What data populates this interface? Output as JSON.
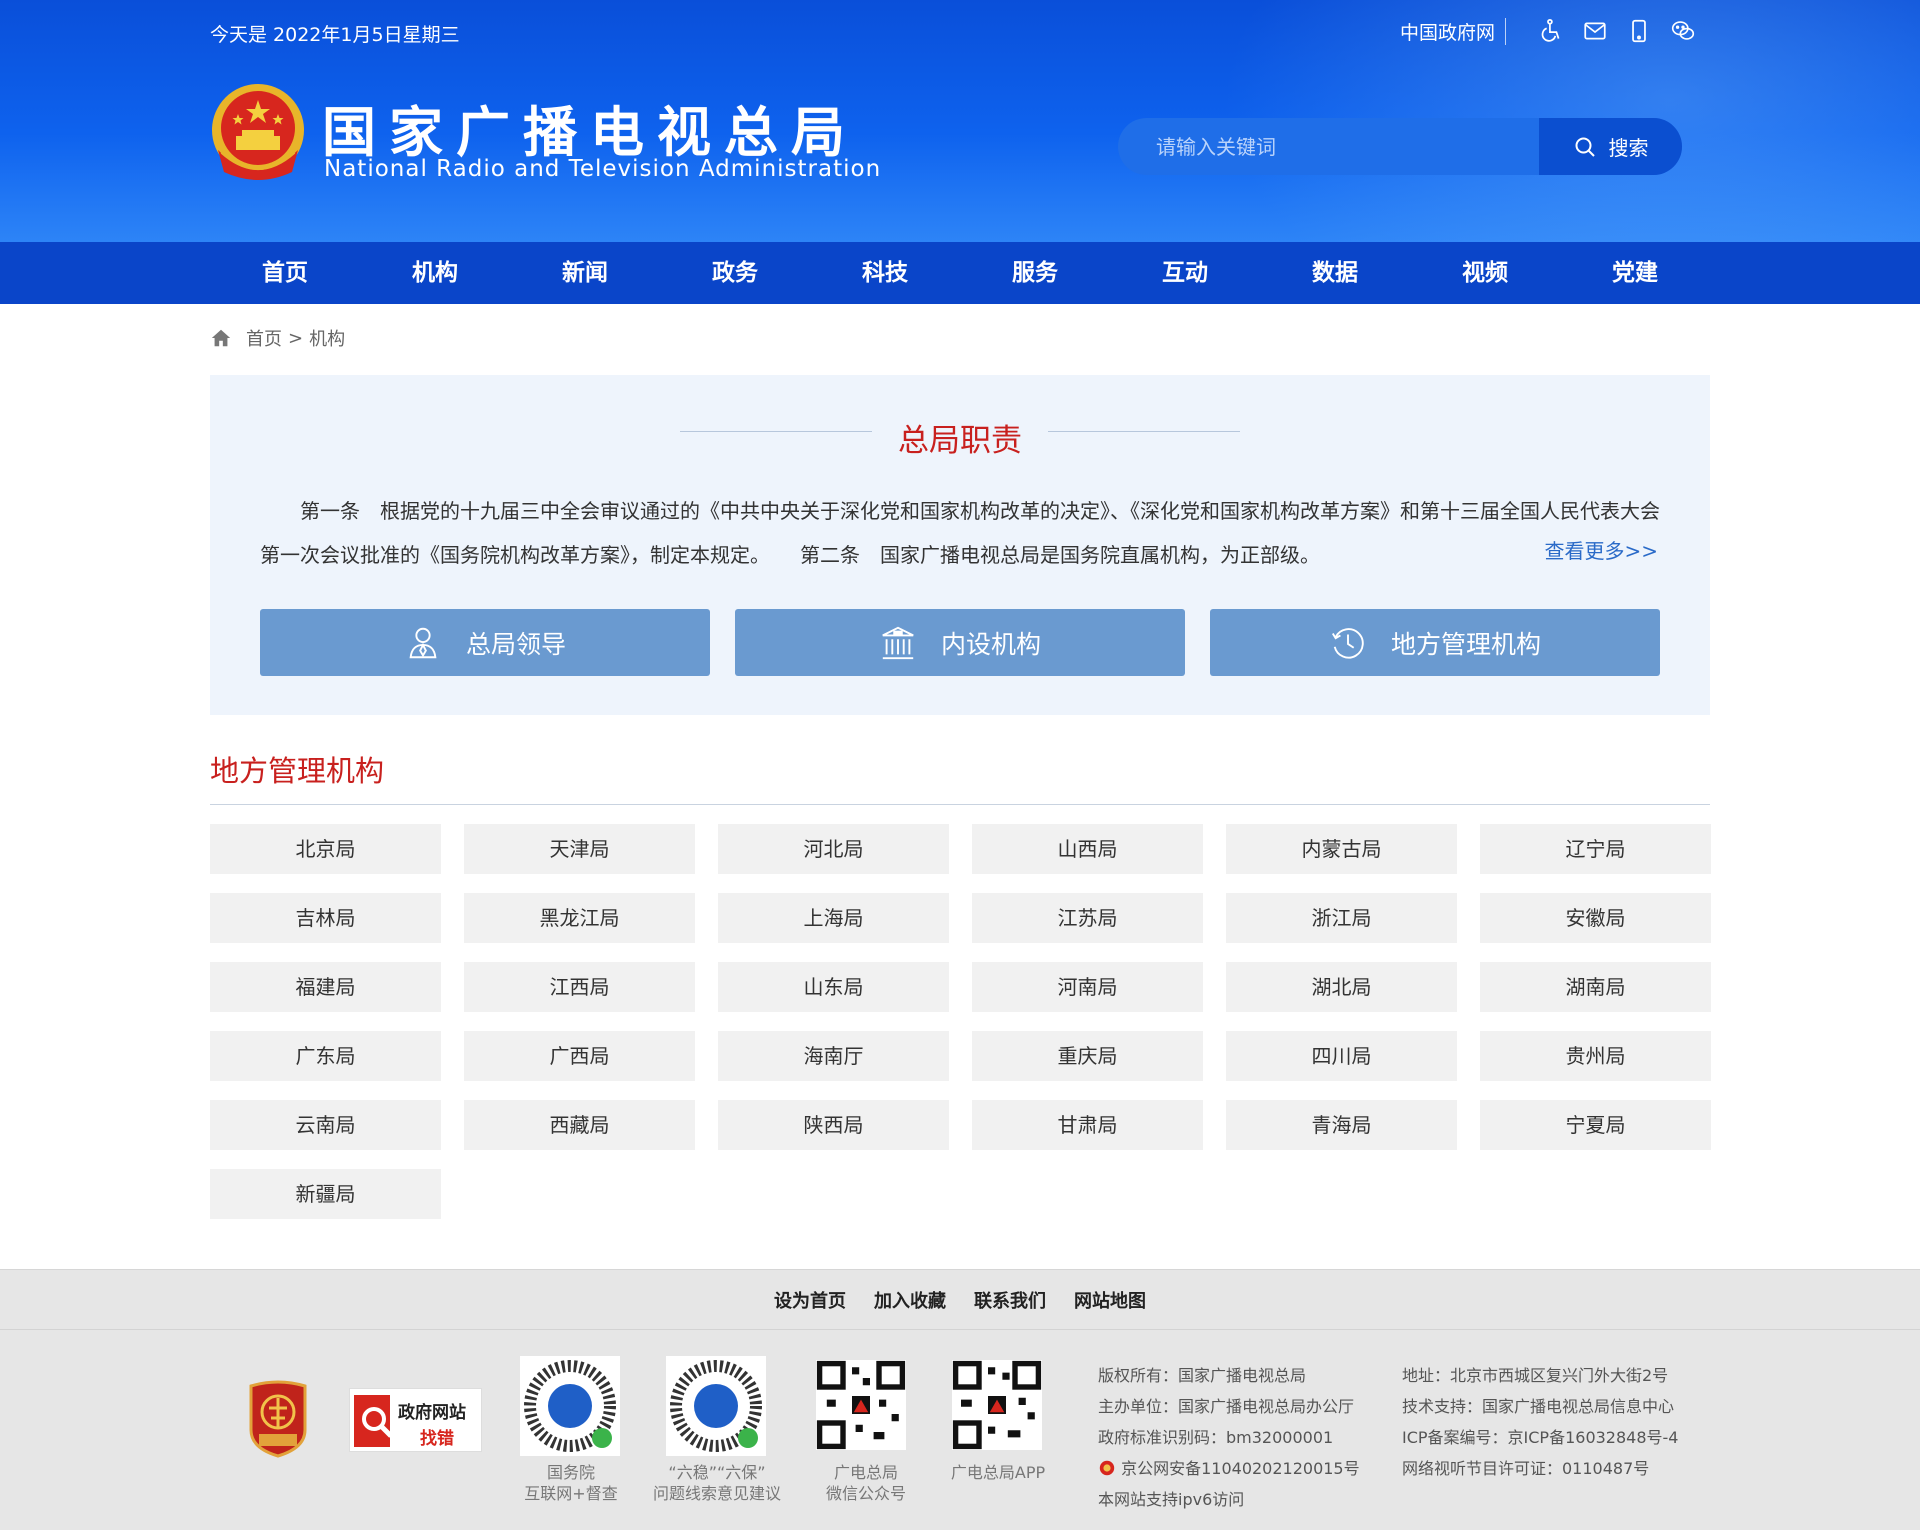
{
  "header": {
    "date": "今天是 2022年1月5日星期三",
    "gov_link": "中国政府网",
    "icons": [
      "accessibility-icon",
      "mail-icon",
      "mobile-icon",
      "wechat-icon"
    ],
    "title": "国家广播电视总局",
    "subtitle": "National Radio and Television Administration",
    "search_placeholder": "请输入关键词",
    "search_button": "搜索",
    "colors": {
      "header_blue": "#0e62ee",
      "nav_blue": "#0a45c9",
      "accent_red": "#c8201e"
    }
  },
  "nav": {
    "items": [
      "首页",
      "机构",
      "新闻",
      "政务",
      "科技",
      "服务",
      "互动",
      "数据",
      "视频",
      "党建"
    ]
  },
  "breadcrumb": {
    "home": "首页",
    "separator": ">",
    "current": "机构"
  },
  "duty": {
    "title": "总局职责",
    "text": "第一条　根据党的十九届三中全会审议通过的《中共中央关于深化党和国家机构改革的决定》、《深化党和国家机构改革方案》和第十三届全国人民代表大会第一次会议批准的《国务院机构改革方案》，制定本规定。　　第二条　国家广播电视总局是国务院直属机构，为正部级。",
    "more": "查看更多>>",
    "buttons": [
      {
        "label": "总局领导",
        "icon": "person-icon"
      },
      {
        "label": "内设机构",
        "icon": "building-icon"
      },
      {
        "label": "地方管理机构",
        "icon": "history-clock-icon"
      }
    ]
  },
  "local": {
    "title": "地方管理机构",
    "items": [
      "北京局",
      "天津局",
      "河北局",
      "山西局",
      "内蒙古局",
      "辽宁局",
      "吉林局",
      "黑龙江局",
      "上海局",
      "江苏局",
      "浙江局",
      "安徽局",
      "福建局",
      "江西局",
      "山东局",
      "河南局",
      "湖北局",
      "湖南局",
      "广东局",
      "广西局",
      "海南厅",
      "重庆局",
      "四川局",
      "贵州局",
      "云南局",
      "西藏局",
      "陕西局",
      "甘肃局",
      "青海局",
      "宁夏局",
      "新疆局"
    ]
  },
  "footer": {
    "links": [
      "设为首页",
      "加入收藏",
      "联系我们",
      "网站地图"
    ],
    "party_badge": "党政机关",
    "err_badge_top": "政府网站",
    "err_badge_bottom": "找错",
    "qr": [
      {
        "line1": "国务院",
        "line2": "互联网+督查"
      },
      {
        "line1": "“六稳”“六保”",
        "line2": "问题线索意见建议"
      },
      {
        "line1": "广电总局",
        "line2": "微信公众号"
      },
      {
        "line1": "广电总局APP",
        "line2": ""
      }
    ],
    "info_left": [
      "版权所有：国家广播电视总局",
      "主办单位：国家广播电视总局办公厅",
      "政府标准识别码：bm32000001",
      "京公网安备11040202120015号",
      "本网站支持ipv6访问"
    ],
    "info_right": [
      "地址：北京市西城区复兴门外大街2号",
      "技术支持：国家广播电视总局信息中心",
      "ICP备案编号：京ICP备16032848号-4",
      "网络视听节目许可证：0110487号"
    ]
  }
}
